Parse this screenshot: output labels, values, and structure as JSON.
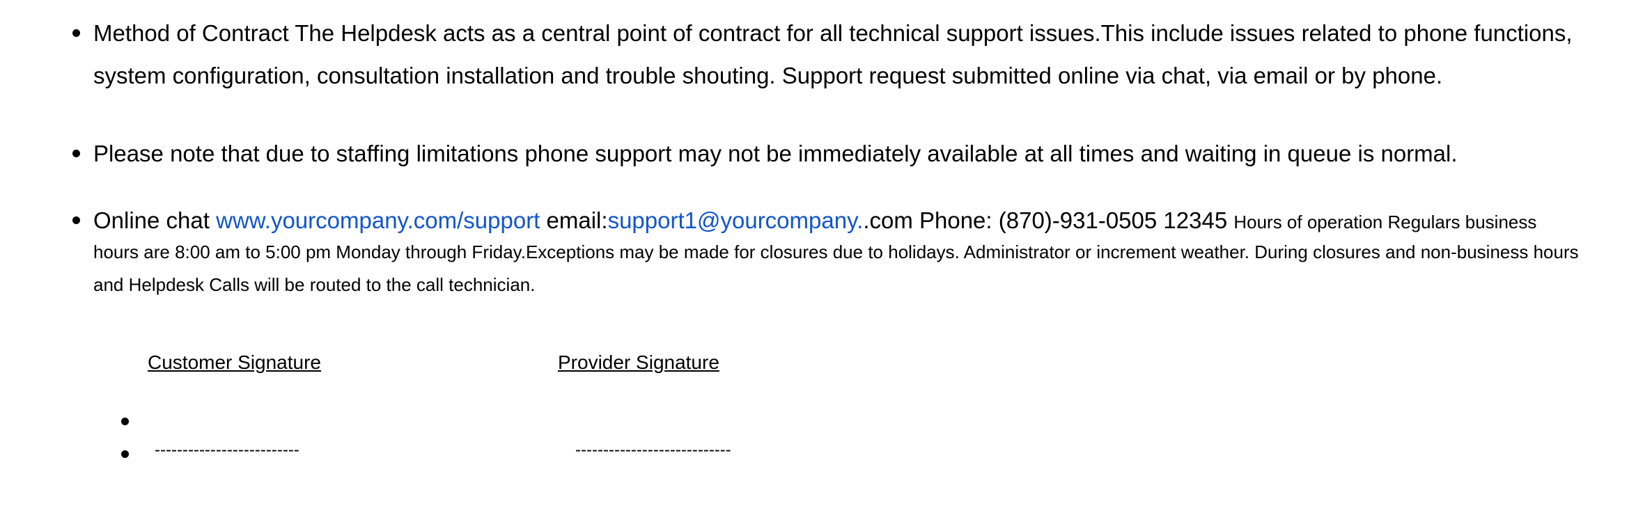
{
  "bullets": {
    "method": {
      "text": "Method of Contract The Helpdesk acts as a central point of contract for all technical support issues.This include issues related to phone functions, system configuration, consultation installation and trouble shouting. Support request submitted online via chat, via email or by phone."
    },
    "note": {
      "text": "Please note that due to staffing limitations phone support may not be immediately available at all times and waiting in queue is normal."
    },
    "contact": {
      "chat_label": "Online chat ",
      "chat_link": "www.yourcompany.com/support",
      "email_label": " email:",
      "email_link": "support1@yourcompany.",
      "email_suffix": ".com Phone: (870)-931-0505 12345 ",
      "hours_lead": "Hours of operation Regulars business",
      "hours_rest": "hours are 8:00 am to 5:00 pm Monday through Friday.Exceptions may be made for closures due to holidays. Administrator or increment weather. During closures and non-business hours and Helpdesk Calls will be routed to the call technician."
    }
  },
  "signatures": {
    "customer_label": "Customer Signature",
    "provider_label": "Provider Signature",
    "customer_line": "--------------------------",
    "provider_line": "----------------------------"
  },
  "colors": {
    "link": "#1155cc",
    "text": "#000000",
    "background": "#ffffff"
  }
}
